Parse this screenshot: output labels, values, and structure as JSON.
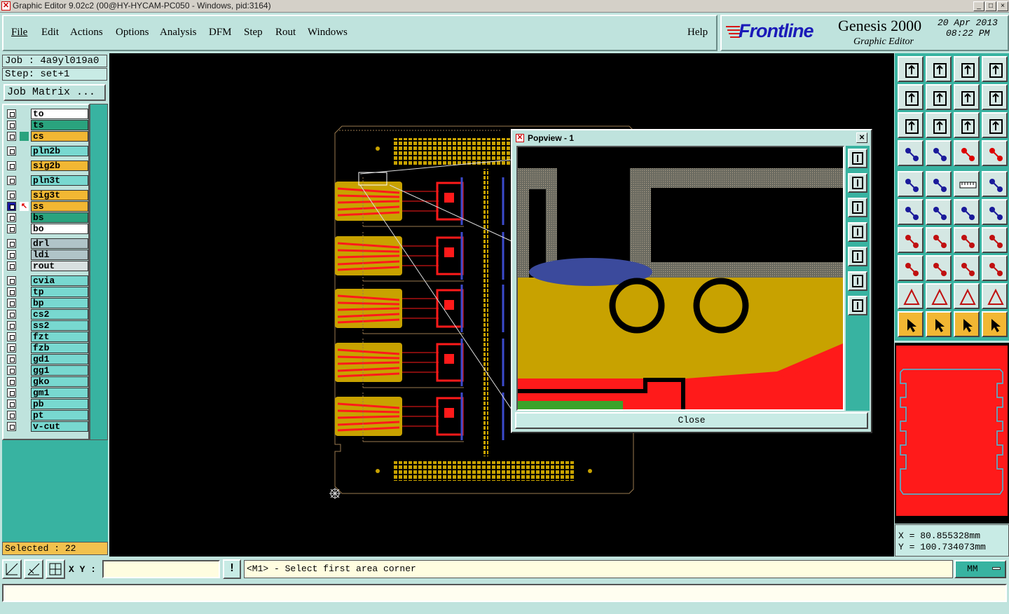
{
  "window": {
    "title": "Graphic Editor 9.02c2 (00@HY-HYCAM-PC050 - Windows, pid:3164)",
    "btn_min": "_",
    "btn_max": "□",
    "btn_close": "×"
  },
  "menu": {
    "items": [
      "File",
      "Edit",
      "Actions",
      "Options",
      "Analysis",
      "DFM",
      "Step",
      "Rout",
      "Windows"
    ],
    "help": "Help"
  },
  "brand": {
    "logo": "Frontline",
    "product": "Genesis 2000",
    "subtitle": "Graphic Editor",
    "date": "20 Apr 2013",
    "time": "08:22 PM"
  },
  "job": {
    "job_line": "Job : 4a9yl019a0",
    "step_line": "Step: set+1",
    "matrix_button": "Job Matrix ..."
  },
  "layers": [
    {
      "name": "to",
      "color": "#ffffff"
    },
    {
      "name": "ts",
      "color": "#2aa37e"
    },
    {
      "name": "cs",
      "color": "#f2b733",
      "marker": "#2aa37e"
    },
    {
      "name": "pln2b",
      "color": "#78d8d0"
    },
    {
      "name": "sig2b",
      "color": "#f2b733"
    },
    {
      "name": "pln3t",
      "color": "#78d8d0"
    },
    {
      "name": "sig3t",
      "color": "#f2b733"
    },
    {
      "name": "ss",
      "color": "#f2b733",
      "active": true
    },
    {
      "name": "bs",
      "color": "#2aa37e"
    },
    {
      "name": "bo",
      "color": "#ffffff"
    },
    {
      "name": "drl",
      "color": "#b0c4c8"
    },
    {
      "name": "ldi",
      "color": "#b0c4c8"
    },
    {
      "name": "rout",
      "color": "#d8e0e0"
    },
    {
      "name": "cvia",
      "color": "#78d8d0"
    },
    {
      "name": "tp",
      "color": "#78d8d0"
    },
    {
      "name": "bp",
      "color": "#78d8d0"
    },
    {
      "name": "cs2",
      "color": "#78d8d0"
    },
    {
      "name": "ss2",
      "color": "#78d8d0"
    },
    {
      "name": "fzt",
      "color": "#78d8d0"
    },
    {
      "name": "fzb",
      "color": "#78d8d0"
    },
    {
      "name": "gd1",
      "color": "#78d8d0"
    },
    {
      "name": "gg1",
      "color": "#78d8d0"
    },
    {
      "name": "gko",
      "color": "#78d8d0"
    },
    {
      "name": "gm1",
      "color": "#78d8d0"
    },
    {
      "name": "pb",
      "color": "#78d8d0"
    },
    {
      "name": "pt",
      "color": "#78d8d0"
    },
    {
      "name": "v-cut",
      "color": "#78d8d0"
    }
  ],
  "selected": "Selected : 22",
  "popup": {
    "title": "Popview - 1",
    "close_label": "Close"
  },
  "coords": {
    "x": "X  =  80.855328mm",
    "y": "Y  = 100.734073mm"
  },
  "statusbar": {
    "xy_label": "X Y :",
    "xy_value": "",
    "alert": "!",
    "prompt": "<M1> - Select first area corner",
    "units": "MM"
  },
  "colors": {
    "copper": "#c8a200",
    "trace": "#ff1a1a",
    "outline": "#b89060",
    "panel": "#bfe3dd",
    "accent": "#38b3a1"
  }
}
